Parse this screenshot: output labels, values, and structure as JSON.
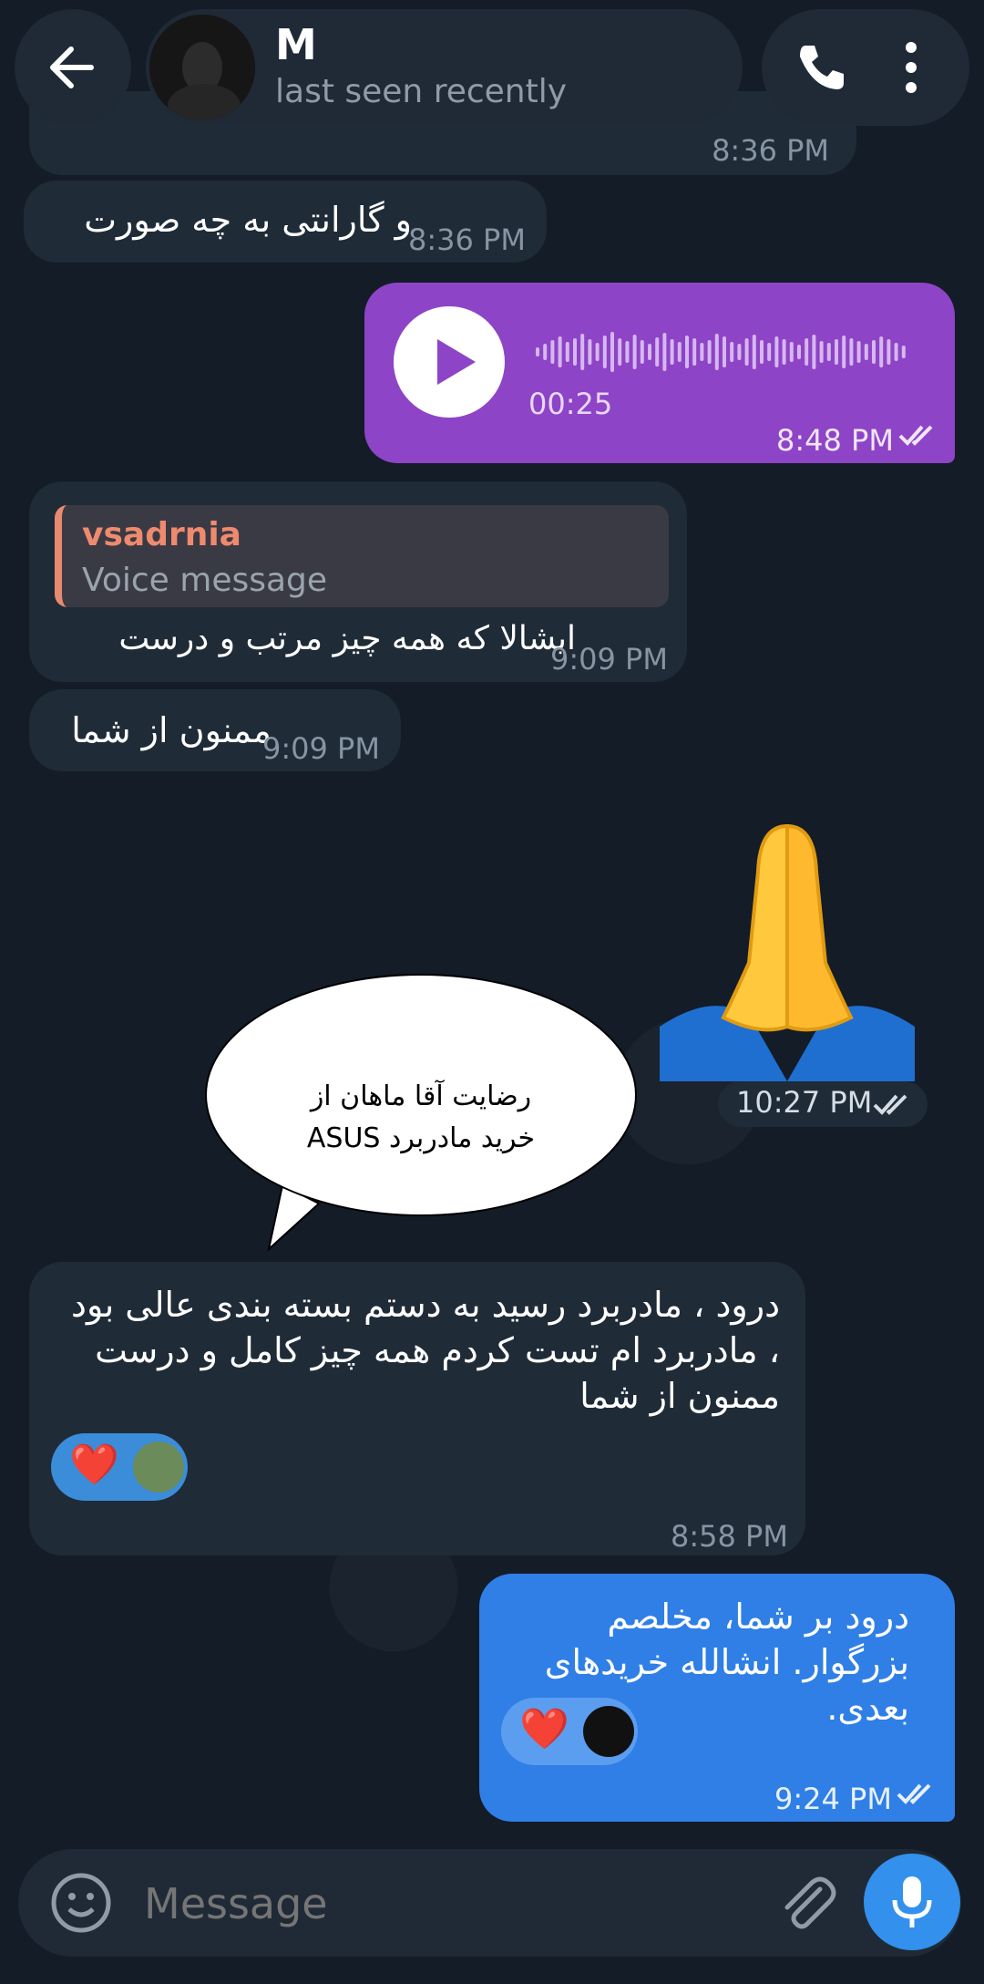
{
  "header": {
    "name": "M",
    "status": "last seen recently"
  },
  "messages": {
    "m1_time": "8:36 PM",
    "m2_text": "و گارانتی به چه صورت",
    "m2_time": "8:36 PM",
    "voice_duration": "00:25",
    "voice_time": "8:48 PM",
    "reply_author": "vsadrnia",
    "reply_preview": "Voice message",
    "m3_text": "ایشالا که همه چیز مرتب و درست",
    "m3_time": "9:09 PM",
    "m4_text": "ممنون از شما",
    "m4_time": "9:09 PM",
    "emoji_time": "10:27 PM",
    "speech_text": "رضایت آقا ماهان از خرید مادربرد ASUS",
    "m5_text": "درود ، مادربرد رسید به دستم بسته بندی عالی بود ، مادربرد ام تست کردم همه چیز کامل و درست ممنون از شما",
    "m5_reaction": "❤️",
    "m5_time": "8:58 PM",
    "m6_text": "درود بر شما، مخلصم بزرگوار. انشالله خریدهای بعدی.",
    "m6_reaction": "❤️",
    "m6_time": "9:24 PM"
  },
  "input": {
    "placeholder": "Message"
  },
  "colors": {
    "voice_bubble": "#8e44c6",
    "outgoing_bubble": "#2f7fe6",
    "accent": "#3390ec",
    "reply_bar": "#e88a70"
  }
}
